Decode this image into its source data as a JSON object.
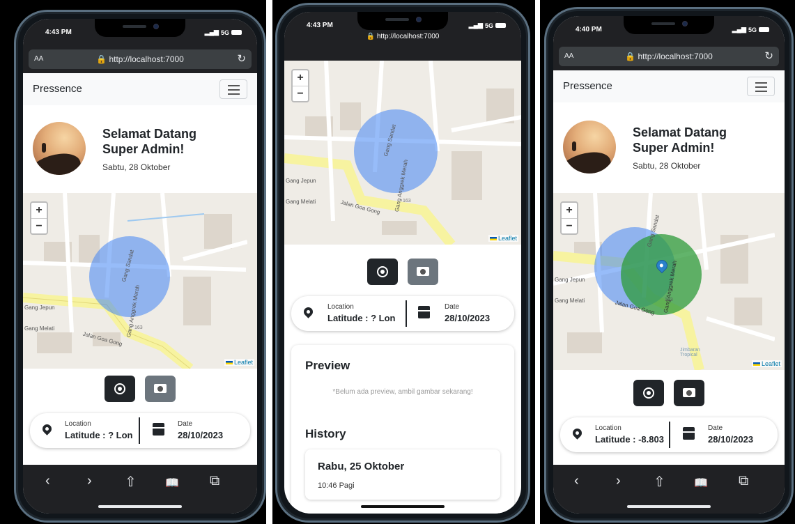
{
  "phones": [
    {
      "status": {
        "time": "4:43 PM",
        "signal": "5G"
      },
      "browser": {
        "aa_label": "AA",
        "url": "http://localhost:7000",
        "reload_icon": "reload-icon"
      },
      "navbar": {
        "brand": "Pressence",
        "toggler_icon": "hamburger-icon"
      },
      "welcome": {
        "title": "Selamat Datang Super Admin!",
        "date": "Sabtu, 28 Oktober"
      },
      "map": {
        "zoom_in": "+",
        "zoom_out": "−",
        "attribution": "Leaflet",
        "streets": [
          "Gang Sandat",
          "Gang Anggrek Merah",
          "Gang Jepun",
          "Gang Melati",
          "Jalan Goa Gong",
          "163"
        ]
      },
      "info": {
        "location_label": "Location",
        "location_value": "Latitude : ? Lon",
        "date_label": "Date",
        "date_value": "28/10/2023"
      },
      "toolbar": {
        "back": "‹",
        "forward": "›",
        "share": "⇧",
        "bookmarks": "📖",
        "tabs": "⧉"
      }
    },
    {
      "status": {
        "time": "4:43 PM",
        "signal": "5G"
      },
      "browser": {
        "url": "http://localhost:7000"
      },
      "map": {
        "zoom_in": "+",
        "zoom_out": "−",
        "attribution": "Leaflet",
        "streets": [
          "Gang Sandat",
          "Gang Anggrek Merah",
          "Gang Jepun",
          "Gang Melati",
          "Jalan Goa Gong",
          "163"
        ]
      },
      "info": {
        "location_label": "Location",
        "location_value": "Latitude : ? Lon",
        "date_label": "Date",
        "date_value": "28/10/2023"
      },
      "preview": {
        "title": "Preview",
        "empty_text": "*Belum ada preview, ambil gambar sekarang!"
      },
      "history": {
        "title": "History",
        "items": [
          {
            "date": "Rabu, 25 Oktober",
            "time": "10:46 Pagi"
          }
        ]
      }
    },
    {
      "status": {
        "time": "4:40 PM",
        "signal": "5G"
      },
      "browser": {
        "aa_label": "AA",
        "url": "http://localhost:7000"
      },
      "navbar": {
        "brand": "Pressence"
      },
      "welcome": {
        "title": "Selamat Datang Super Admin!",
        "date": "Sabtu, 28 Oktober"
      },
      "map": {
        "zoom_in": "+",
        "zoom_out": "−",
        "attribution": "Leaflet",
        "streets": [
          "Gang Sandat",
          "Gang Anggrek Merah",
          "Gang Jepun",
          "Gang Melati",
          "Jalan Goa Gong",
          "163",
          "Jimbaran Tropical"
        ]
      },
      "info": {
        "location_label": "Location",
        "location_value": "Latitude : -8.803",
        "date_label": "Date",
        "date_value": "28/10/2023"
      },
      "toolbar": {
        "back": "‹",
        "forward": "›",
        "share": "⇧",
        "bookmarks": "📖",
        "tabs": "⧉"
      }
    }
  ],
  "colors": {
    "dark_button": "#212529",
    "radius_blue": "#4285f4",
    "radius_green": "#34a853",
    "road_yellow": "#f7f3a0"
  }
}
